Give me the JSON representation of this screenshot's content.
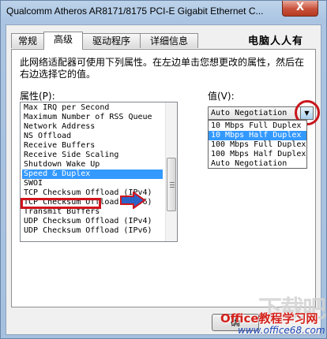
{
  "window": {
    "title": "Qualcomm Atheros AR8171/8175 PCI-E Gigabit Ethernet C...",
    "close_label": "X"
  },
  "tabs": [
    {
      "label": "常规"
    },
    {
      "label": "高级"
    },
    {
      "label": "驱动程序"
    },
    {
      "label": "详细信息"
    }
  ],
  "brand": "电脑人人有",
  "advanced": {
    "description": "此网络适配器可使用下列属性。在左边单击您想更改的属性，然后在右边选择它的值。",
    "property_label": "属性(P):",
    "value_label": "值(V):",
    "properties": [
      "Max IRQ per Second",
      "Maximum Number of RSS Queue",
      "Network Address",
      "NS Offload",
      "Receive Buffers",
      "Receive Side Scaling",
      "Shutdown Wake Up",
      "Speed & Duplex",
      "SWOI",
      "TCP Checksum Offload (IPv4)",
      "TCP Checksum Offload (IPv6)",
      "Transmit Buffers",
      "UDP Checksum Offload (IPv4)",
      "UDP Checksum Offload (IPv6)"
    ],
    "selected_property": "Speed & Duplex",
    "value_selected": "Auto Negotiation",
    "value_options": [
      "10 Mbps Full Duplex",
      "10 Mbps Half Duplex",
      "100 Mbps Full Duplex",
      "100 Mbps Half Duplex",
      "Auto Negotiation"
    ],
    "highlighted_option": "10 Mbps Half Duplex"
  },
  "buttons": {
    "ok": "确"
  },
  "watermarks": {
    "site_logo": "下载吧",
    "office_brand": "Office教程学习网",
    "office_url": "www.office68.com"
  },
  "colors": {
    "selection": "#3399ff",
    "annotation_red": "#d0151d",
    "annotation_blue": "#2b63c7"
  }
}
